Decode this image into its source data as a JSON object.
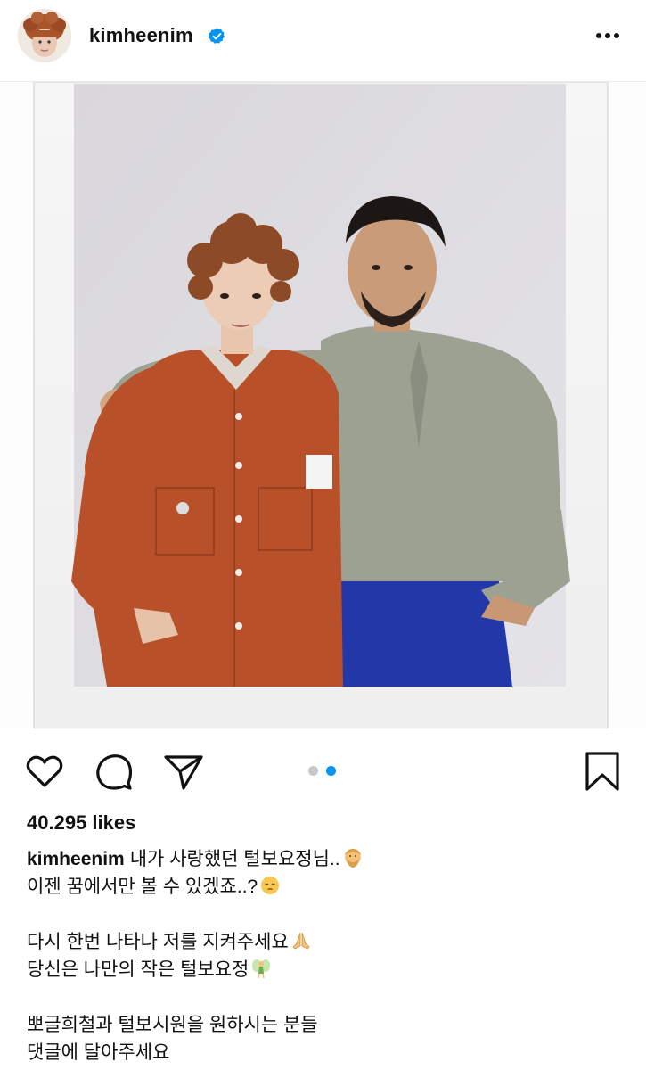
{
  "header": {
    "username": "kimheenim",
    "avatar_icon": "profile-avatar",
    "verified_icon": "verified-badge-icon",
    "more_icon": "more-options-icon"
  },
  "post": {
    "image_description_icon": "polaroid-photo",
    "carousel": {
      "count": 2,
      "active_index": 1
    }
  },
  "actions": {
    "like_icon": "heart-icon",
    "comment_icon": "comment-icon",
    "share_icon": "paper-plane-icon",
    "save_icon": "bookmark-icon"
  },
  "likes": "40.295 likes",
  "caption": {
    "username": "kimheenim",
    "line1": "내가 사랑했던 털보요정님..",
    "line2": "이젠 꿈에서만 볼 수 있겠죠..?",
    "line3": "다시 한번 나타나 저를 지켜주세요",
    "line4": "당신은 나만의 작은 털보요정",
    "line5": "뽀글희철과 털보시원을 원하시는 분들",
    "line6": "댓글에 달아주세요"
  },
  "colors": {
    "accent_blue": "#0095f6",
    "dot_inactive": "#c8c8c8",
    "text": "#111111"
  }
}
